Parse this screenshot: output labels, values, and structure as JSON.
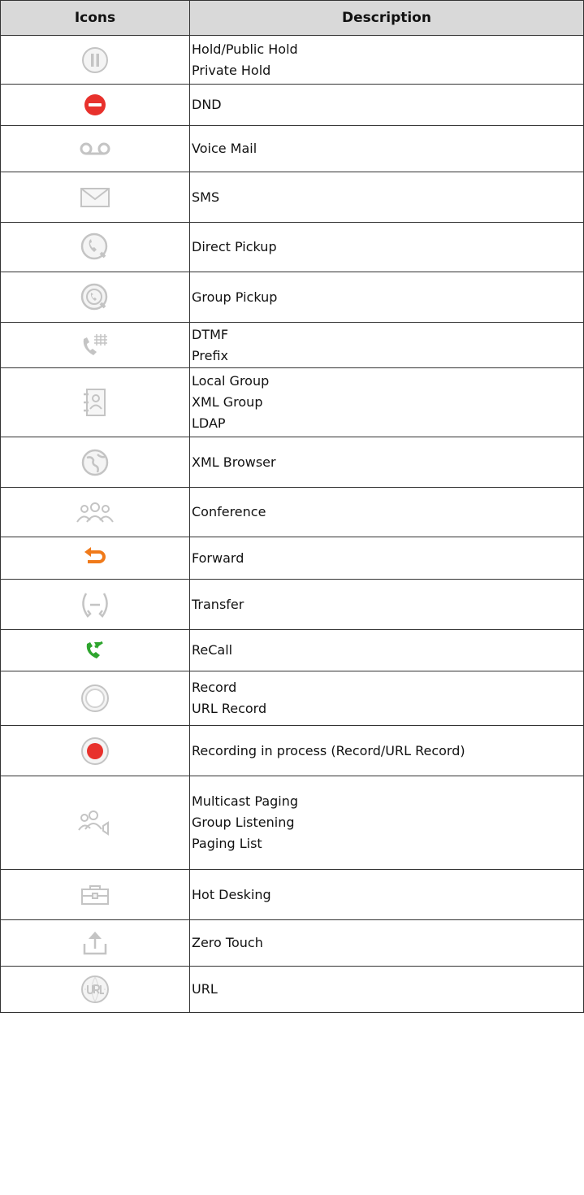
{
  "header": {
    "icons": "Icons",
    "description": "Description"
  },
  "rows": [
    {
      "icon": "hold-icon",
      "lines": [
        "Hold/Public Hold",
        "Private Hold"
      ]
    },
    {
      "icon": "dnd-icon",
      "lines": [
        "DND"
      ]
    },
    {
      "icon": "voice-mail-icon",
      "lines": [
        "Voice Mail"
      ]
    },
    {
      "icon": "sms-envelope-icon",
      "lines": [
        "SMS"
      ]
    },
    {
      "icon": "direct-pickup-icon",
      "lines": [
        "Direct Pickup"
      ]
    },
    {
      "icon": "group-pickup-icon",
      "lines": [
        "Group Pickup"
      ]
    },
    {
      "icon": "dtmf-icon",
      "lines": [
        "DTMF",
        "Prefix"
      ]
    },
    {
      "icon": "directory-icon",
      "lines": [
        "Local Group",
        "XML Group",
        "LDAP"
      ]
    },
    {
      "icon": "xml-browser-icon",
      "lines": [
        "XML Browser"
      ]
    },
    {
      "icon": "conference-icon",
      "lines": [
        "Conference"
      ]
    },
    {
      "icon": "forward-icon",
      "lines": [
        "Forward"
      ]
    },
    {
      "icon": "transfer-icon",
      "lines": [
        "Transfer"
      ]
    },
    {
      "icon": "recall-icon",
      "lines": [
        "ReCall"
      ]
    },
    {
      "icon": "record-icon",
      "lines": [
        "Record",
        "URL Record"
      ]
    },
    {
      "icon": "recording-in-process-icon",
      "lines": [
        "Recording in process (Record/URL Record)"
      ]
    },
    {
      "icon": "paging-icon",
      "lines": [
        "Multicast Paging",
        "Group Listening",
        "Paging List"
      ]
    },
    {
      "icon": "hot-desking-icon",
      "lines": [
        "Hot Desking"
      ]
    },
    {
      "icon": "zero-touch-icon",
      "lines": [
        "Zero Touch"
      ]
    },
    {
      "icon": "url-icon",
      "lines": [
        "URL"
      ]
    }
  ],
  "colors": {
    "header_bg": "#d9d9d9",
    "dnd_red": "#e8312c",
    "forward_orange": "#f07a1a",
    "recall_green": "#2ea52e",
    "icon_gray": "#c8c8c8"
  }
}
